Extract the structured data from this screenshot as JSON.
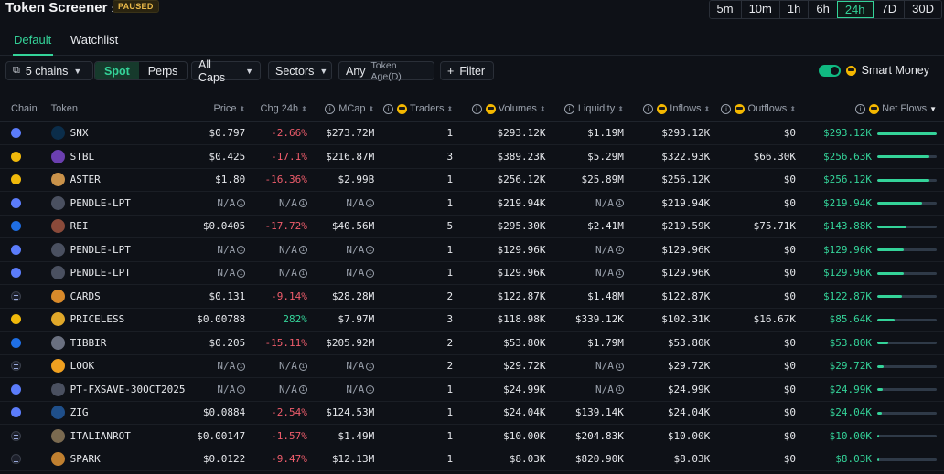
{
  "header": {
    "title": "Token Screener",
    "status_badge": "PAUSED",
    "timeframes": [
      "5m",
      "10m",
      "1h",
      "6h",
      "24h",
      "7D",
      "30D"
    ],
    "active_timeframe": "24h"
  },
  "tabs": [
    {
      "label": "Default",
      "active": true
    },
    {
      "label": "Watchlist",
      "active": false
    }
  ],
  "filters": {
    "chains": "5 chains",
    "market_types": [
      "Spot",
      "Perps"
    ],
    "active_market_type": "Spot",
    "caps": "All Caps",
    "sectors": "Sectors",
    "age_value": "Any",
    "age_label": "Token Age(D)",
    "filter": "Filter",
    "smart_money": "Smart Money",
    "smart_money_on": true
  },
  "columns": {
    "chain": "Chain",
    "token": "Token",
    "price": "Price",
    "chg": "Chg 24h",
    "mcap": "MCap",
    "traders": "Traders",
    "volumes": "Volumes",
    "liquidity": "Liquidity",
    "inflows": "Inflows",
    "outflows": "Outflows",
    "netflows": "Net Flows"
  },
  "rows": [
    {
      "chain": "ethereum",
      "icon": "snx-icon",
      "icon_color": "#0b2d4a",
      "token": "SNX",
      "price": "$0.797",
      "chg": "-2.66%",
      "chg_dir": "neg",
      "mcap": "$273.72M",
      "traders": "1",
      "volumes": "$293.12K",
      "liquidity": "$1.19M",
      "inflows": "$293.12K",
      "outflows": "$0",
      "netflows": "$293.12K",
      "flow_fraction": 1.0
    },
    {
      "chain": "bsc",
      "icon": "stbl-icon",
      "icon_color": "#6b3fb0",
      "token": "STBL",
      "price": "$0.425",
      "chg": "-17.1%",
      "chg_dir": "neg",
      "mcap": "$216.87M",
      "traders": "3",
      "volumes": "$389.23K",
      "liquidity": "$5.29M",
      "inflows": "$322.93K",
      "outflows": "$66.30K",
      "netflows": "$256.63K",
      "flow_fraction": 0.87
    },
    {
      "chain": "bsc",
      "icon": "aster-icon",
      "icon_color": "#c9924a",
      "token": "ASTER",
      "price": "$1.80",
      "chg": "-16.36%",
      "chg_dir": "neg",
      "mcap": "$2.99B",
      "traders": "1",
      "volumes": "$256.12K",
      "liquidity": "$25.89M",
      "inflows": "$256.12K",
      "outflows": "$0",
      "netflows": "$256.12K",
      "flow_fraction": 0.87
    },
    {
      "chain": "ethereum",
      "icon": "pendle-icon",
      "icon_color": "#4a5060",
      "token": "PENDLE-LPT",
      "price": "N/A",
      "chg": "N/A",
      "chg_dir": "na",
      "mcap": "N/A",
      "traders": "1",
      "volumes": "$219.94K",
      "liquidity": "N/A",
      "inflows": "$219.94K",
      "outflows": "$0",
      "netflows": "$219.94K",
      "flow_fraction": 0.75
    },
    {
      "chain": "base",
      "icon": "rei-icon",
      "icon_color": "#8a4a3a",
      "token": "REI",
      "price": "$0.0405",
      "chg": "-17.72%",
      "chg_dir": "neg",
      "mcap": "$40.56M",
      "traders": "5",
      "volumes": "$295.30K",
      "liquidity": "$2.41M",
      "inflows": "$219.59K",
      "outflows": "$75.71K",
      "netflows": "$143.88K",
      "flow_fraction": 0.49
    },
    {
      "chain": "ethereum",
      "icon": "pendle-icon",
      "icon_color": "#4a5060",
      "token": "PENDLE-LPT",
      "price": "N/A",
      "chg": "N/A",
      "chg_dir": "na",
      "mcap": "N/A",
      "traders": "1",
      "volumes": "$129.96K",
      "liquidity": "N/A",
      "inflows": "$129.96K",
      "outflows": "$0",
      "netflows": "$129.96K",
      "flow_fraction": 0.44
    },
    {
      "chain": "ethereum",
      "icon": "pendle-icon",
      "icon_color": "#4a5060",
      "token": "PENDLE-LPT",
      "price": "N/A",
      "chg": "N/A",
      "chg_dir": "na",
      "mcap": "N/A",
      "traders": "1",
      "volumes": "$129.96K",
      "liquidity": "N/A",
      "inflows": "$129.96K",
      "outflows": "$0",
      "netflows": "$129.96K",
      "flow_fraction": 0.44
    },
    {
      "chain": "solana",
      "icon": "cards-icon",
      "icon_color": "#d98a2a",
      "token": "CARDS",
      "price": "$0.131",
      "chg": "-9.14%",
      "chg_dir": "neg",
      "mcap": "$28.28M",
      "traders": "2",
      "volumes": "$122.87K",
      "liquidity": "$1.48M",
      "inflows": "$122.87K",
      "outflows": "$0",
      "netflows": "$122.87K",
      "flow_fraction": 0.42
    },
    {
      "chain": "bsc",
      "icon": "priceless-icon",
      "icon_color": "#e0a82a",
      "token": "PRICELESS",
      "price": "$0.00788",
      "chg": "282%",
      "chg_dir": "pos",
      "mcap": "$7.97M",
      "traders": "3",
      "volumes": "$118.98K",
      "liquidity": "$339.12K",
      "inflows": "$102.31K",
      "outflows": "$16.67K",
      "netflows": "$85.64K",
      "flow_fraction": 0.29
    },
    {
      "chain": "base",
      "icon": "tibbir-icon",
      "icon_color": "#6a7080",
      "token": "TIBBIR",
      "price": "$0.205",
      "chg": "-15.11%",
      "chg_dir": "neg",
      "mcap": "$205.92M",
      "traders": "2",
      "volumes": "$53.80K",
      "liquidity": "$1.79M",
      "inflows": "$53.80K",
      "outflows": "$0",
      "netflows": "$53.80K",
      "flow_fraction": 0.18
    },
    {
      "chain": "solana",
      "icon": "look-icon",
      "icon_color": "#f0a020",
      "token": "LOOK",
      "price": "N/A",
      "chg": "N/A",
      "chg_dir": "na",
      "mcap": "N/A",
      "traders": "2",
      "volumes": "$29.72K",
      "liquidity": "N/A",
      "inflows": "$29.72K",
      "outflows": "$0",
      "netflows": "$29.72K",
      "flow_fraction": 0.1
    },
    {
      "chain": "ethereum",
      "icon": "pt-icon",
      "icon_color": "#4a5060",
      "token": "PT-FXSAVE-30OCT2025",
      "price": "N/A",
      "chg": "N/A",
      "chg_dir": "na",
      "mcap": "N/A",
      "traders": "1",
      "volumes": "$24.99K",
      "liquidity": "N/A",
      "inflows": "$24.99K",
      "outflows": "$0",
      "netflows": "$24.99K",
      "flow_fraction": 0.085
    },
    {
      "chain": "ethereum",
      "icon": "zig-icon",
      "icon_color": "#1f4f8a",
      "token": "ZIG",
      "price": "$0.0884",
      "chg": "-2.54%",
      "chg_dir": "neg",
      "mcap": "$124.53M",
      "traders": "1",
      "volumes": "$24.04K",
      "liquidity": "$139.14K",
      "inflows": "$24.04K",
      "outflows": "$0",
      "netflows": "$24.04K",
      "flow_fraction": 0.082
    },
    {
      "chain": "solana",
      "icon": "italianrot-icon",
      "icon_color": "#7a6a50",
      "token": "ITALIANROT",
      "price": "$0.00147",
      "chg": "-1.57%",
      "chg_dir": "neg",
      "mcap": "$1.49M",
      "traders": "1",
      "volumes": "$10.00K",
      "liquidity": "$204.83K",
      "inflows": "$10.00K",
      "outflows": "$0",
      "netflows": "$10.00K",
      "flow_fraction": 0.034
    },
    {
      "chain": "solana",
      "icon": "spark-icon",
      "icon_color": "#c08030",
      "token": "SPARK",
      "price": "$0.0122",
      "chg": "-9.47%",
      "chg_dir": "neg",
      "mcap": "$12.13M",
      "traders": "1",
      "volumes": "$8.03K",
      "liquidity": "$820.90K",
      "inflows": "$8.03K",
      "outflows": "$0",
      "netflows": "$8.03K",
      "flow_fraction": 0.027
    }
  ]
}
